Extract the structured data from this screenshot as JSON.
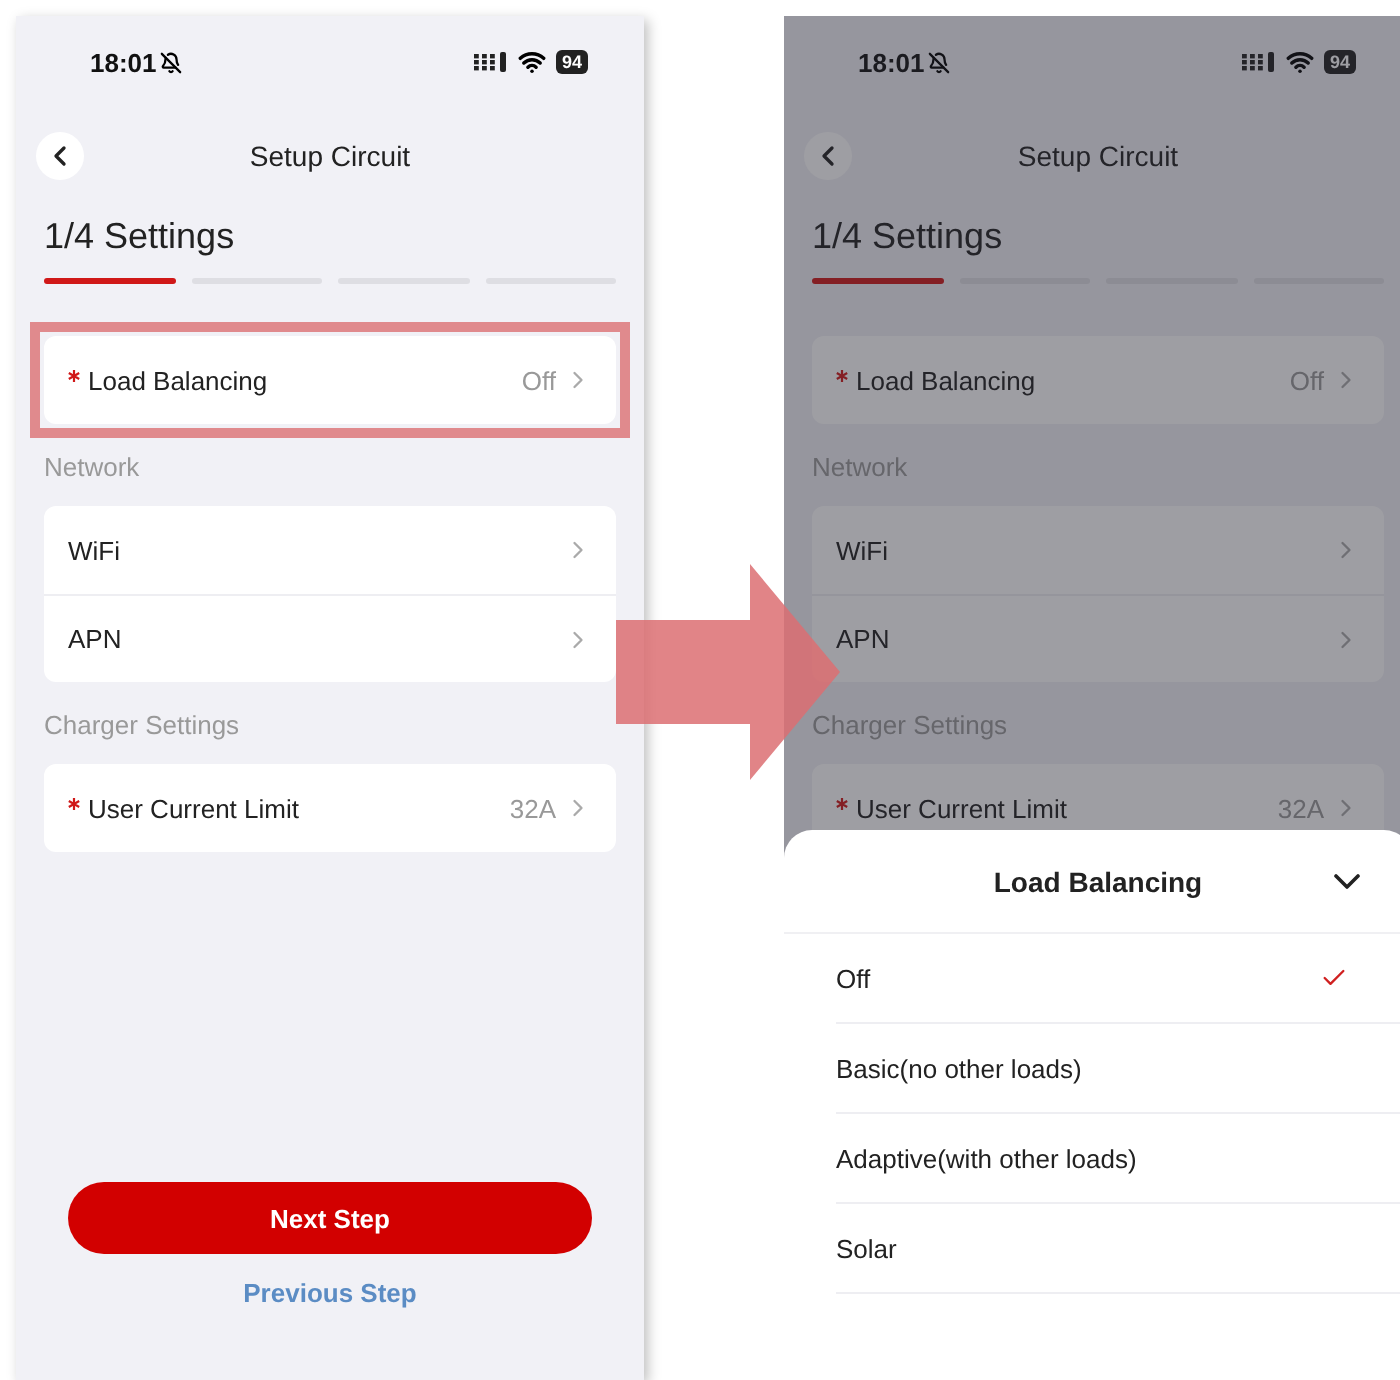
{
  "screens": [
    {
      "dimmed": false,
      "status_bar": {
        "time": "18:01",
        "battery": "94"
      },
      "nav": {
        "title": "Setup Circuit"
      },
      "heading": "1/4 Settings",
      "steps": [
        {
          "selected": true
        },
        {
          "selected": false
        },
        {
          "selected": false
        },
        {
          "selected": false
        }
      ],
      "groups": [
        {
          "rows": [
            {
              "label": "Load Balancing",
              "required": true,
              "value": "Off",
              "highlighted": true
            }
          ]
        },
        {
          "title": "Network",
          "rows": [
            {
              "label": "WiFi",
              "required": false,
              "highlighted": false
            },
            {
              "label": "APN",
              "required": false,
              "highlighted": false
            }
          ]
        },
        {
          "title": "Charger Settings",
          "rows": [
            {
              "label": "User Current Limit",
              "required": true,
              "value": "32A",
              "highlighted": false
            }
          ]
        }
      ],
      "buttons": {
        "next": "Next Step",
        "previous": "Previous Step"
      }
    },
    {
      "dimmed": true,
      "status_bar": {
        "time": "18:01",
        "battery": "94"
      },
      "nav": {
        "title": "Setup Circuit"
      },
      "heading": "1/4 Settings",
      "steps": [
        {
          "selected": true
        },
        {
          "selected": false
        },
        {
          "selected": false
        },
        {
          "selected": false
        }
      ],
      "groups": [
        {
          "rows": [
            {
              "label": "Load Balancing",
              "required": true,
              "value": "Off",
              "highlighted": false
            }
          ]
        },
        {
          "title": "Network",
          "rows": [
            {
              "label": "WiFi",
              "required": false,
              "highlighted": false
            },
            {
              "label": "APN",
              "required": false,
              "highlighted": false
            }
          ]
        },
        {
          "title": "Charger Settings",
          "rows": [
            {
              "label": "User Current Limit",
              "required": true,
              "value": "32A",
              "highlighted": false
            }
          ]
        }
      ],
      "sheet": {
        "title": "Load Balancing",
        "options": [
          {
            "label": "Off",
            "selected": true
          },
          {
            "label": "Basic(no other loads)",
            "selected": false
          },
          {
            "label": "Adaptive(with other loads)",
            "selected": false
          },
          {
            "label": "Solar",
            "selected": false
          }
        ]
      }
    }
  ]
}
